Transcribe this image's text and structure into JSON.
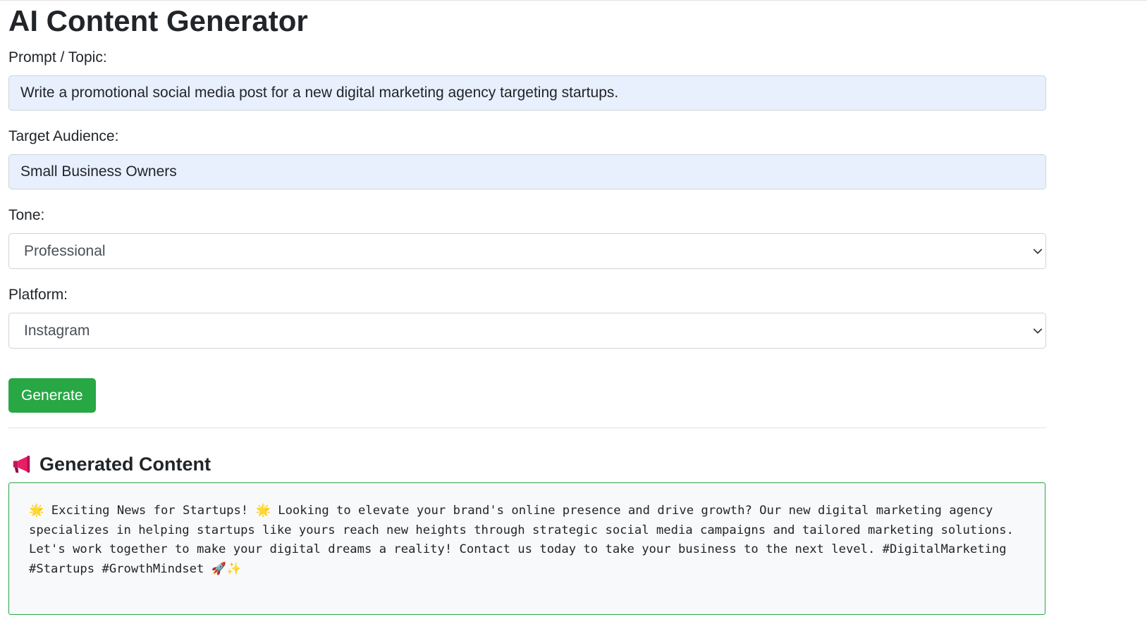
{
  "page": {
    "title": "AI Content Generator"
  },
  "form": {
    "prompt_label": "Prompt / Topic:",
    "prompt_value": "Write a promotional social media post for a new digital marketing agency targeting startups.",
    "audience_label": "Target Audience:",
    "audience_value": "Small Business Owners",
    "tone_label": "Tone:",
    "tone_selected": "Professional",
    "platform_label": "Platform:",
    "platform_selected": "Instagram",
    "generate_label": "Generate"
  },
  "output": {
    "heading": "Generated Content",
    "heading_icon": "megaphone-icon",
    "text": "🌟 Exciting News for Startups! 🌟 Looking to elevate your brand's online presence and drive growth? Our new digital marketing agency specializes in helping startups like yours reach new heights through strategic social media campaigns and tailored marketing solutions. Let's work together to make your digital dreams a reality! Contact us today to take your business to the next level. #DigitalMarketing #Startups #GrowthMindset 🚀✨"
  },
  "colors": {
    "accent": "#28a745",
    "input_autofill_bg": "#e8f0fe",
    "output_bg": "#f8f9fa",
    "border": "#ced4da"
  }
}
